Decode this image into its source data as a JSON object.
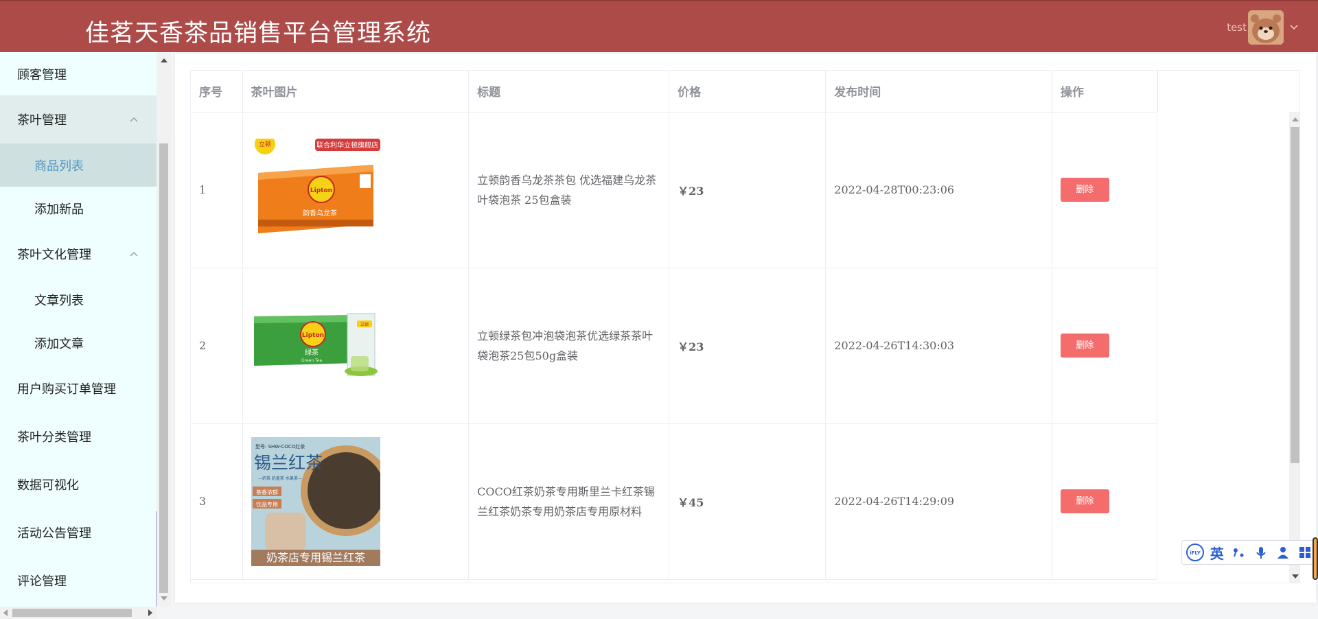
{
  "header": {
    "title": "佳茗天香茶品销售平台管理系统",
    "username": "test"
  },
  "sidebar": {
    "items": [
      {
        "label": "顾客管理"
      },
      {
        "label": "茶叶管理"
      },
      {
        "label": "商品列表"
      },
      {
        "label": "添加新品"
      },
      {
        "label": "茶叶文化管理"
      },
      {
        "label": "文章列表"
      },
      {
        "label": "添加文章"
      },
      {
        "label": "用户购买订单管理"
      },
      {
        "label": "茶叶分类管理"
      },
      {
        "label": "数据可视化"
      },
      {
        "label": "活动公告管理"
      },
      {
        "label": "评论管理"
      }
    ]
  },
  "table": {
    "columns": [
      "序号",
      "茶叶图片",
      "标题",
      "价格",
      "发布时间",
      "操作"
    ],
    "rows": [
      {
        "index": "1",
        "image": {
          "brand": "立顿",
          "banner": "联合利华立顿旗舰店",
          "logo": "Lipton",
          "product": "韵香乌龙茶",
          "color": "#ef7d1a"
        },
        "title": "立顿韵香乌龙茶茶包 优选福建乌龙茶叶袋泡茶 25包盒装",
        "price": "￥23",
        "time": "2022-04-28T00:23:06",
        "action": "删除"
      },
      {
        "index": "2",
        "image": {
          "logo": "Lipton",
          "product": "绿茶",
          "sub": "Green Tea",
          "badge": "立顿",
          "color": "#3a9f3c"
        },
        "title": "立顿绿茶包冲泡袋泡茶优选绿茶茶叶袋泡茶25包50g盒装",
        "price": "￥23",
        "time": "2022-04-26T14:30:03",
        "action": "删除"
      },
      {
        "index": "3",
        "image": {
          "model": "型号: SHW-COCO红茶",
          "name": "锡兰红茶",
          "tagline": "—奶茶 奶盖茶 水果茶—",
          "tag1": "茶香浓郁",
          "tag2": "饮品专用",
          "caption": "奶茶店专用锡兰红茶"
        },
        "title": "COCO红茶奶茶专用斯里兰卡红茶锡兰红茶奶茶专用奶茶店专用原材料",
        "price": "￥45",
        "time": "2022-04-26T14:29:09",
        "action": "删除"
      }
    ]
  },
  "ime": {
    "logo": "iFLY",
    "mode": "英"
  },
  "colors": {
    "header_bg": "#ad4b49",
    "sidebar_bg": "#effefe",
    "active_text": "#4a95c8",
    "price": "#e02020",
    "delete_button": "#f56c6c"
  }
}
